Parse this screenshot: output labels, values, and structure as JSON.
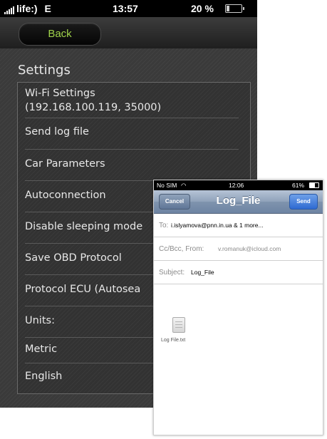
{
  "background_app": {
    "status_bar": {
      "carrier": "life:)",
      "network": "E",
      "time": "13:57",
      "battery": "20 %"
    },
    "nav": {
      "back_label": "Back"
    },
    "section_title": "Settings",
    "items": [
      {
        "label": "Wi-Fi Settings"
      },
      {
        "label": "(192.168.100.119, 35000)"
      },
      {
        "label": "Send log file"
      },
      {
        "label": "Car Parameters"
      },
      {
        "label": "Autoconnection"
      },
      {
        "label": "Disable sleeping mode"
      },
      {
        "label": "Save OBD Protocol"
      },
      {
        "label": "Protocol ECU (Autosea"
      },
      {
        "label": "Units:"
      },
      {
        "label": "Metric"
      },
      {
        "label": "English"
      }
    ]
  },
  "mail_compose": {
    "status_bar": {
      "carrier": "No SIM",
      "time": "12:06",
      "battery": "61%"
    },
    "nav": {
      "cancel_label": "Cancel",
      "title": "Log_File",
      "send_label": "Send"
    },
    "to": {
      "label": "To:",
      "value": "i.islyamova@pnn.in.ua & 1 more..."
    },
    "cc_from": {
      "label": "Cc/Bcc, From:",
      "value": "v.romanuk@icloud.com"
    },
    "subject": {
      "label": "Subject:",
      "value": "Log_File"
    },
    "attachment": {
      "name": "Log File.txt",
      "icon": "document-icon"
    }
  }
}
